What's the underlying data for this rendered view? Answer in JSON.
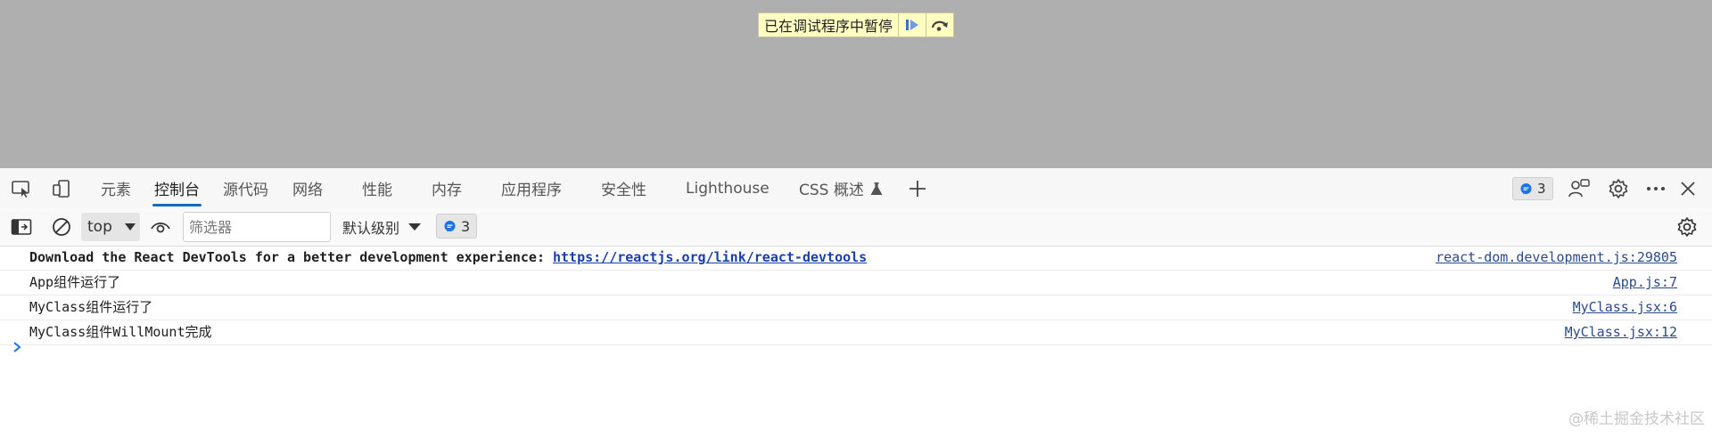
{
  "pause_banner": {
    "text": "已在调试程序中暂停",
    "resume_icon": "resume-icon",
    "step_over_icon": "step-over-icon"
  },
  "toolbar": {
    "tabs": [
      {
        "label": "元素"
      },
      {
        "label": "控制台",
        "active": true
      },
      {
        "label": "源代码"
      },
      {
        "label": "网络"
      },
      {
        "label": "性能"
      },
      {
        "label": "内存"
      },
      {
        "label": "应用程序"
      },
      {
        "label": "安全性"
      },
      {
        "label": "Lighthouse"
      },
      {
        "label": "CSS 概述"
      }
    ],
    "issues_count": "3",
    "accent": "#0f6cbd"
  },
  "console_toolbar": {
    "context": "top",
    "filter_placeholder": "筛选器",
    "level": "默认级别",
    "issues_count": "3"
  },
  "messages": [
    {
      "text": "Download the React DevTools for a better development experience: ",
      "link": "https://reactjs.org/link/react-devtools",
      "source": "react-dom.development.js:29805"
    },
    {
      "text": "App组件运行了",
      "source": "App.js:7"
    },
    {
      "text": "MyClass组件运行了",
      "source": "MyClass.jsx:6"
    },
    {
      "text": "MyClass组件WillMount完成",
      "source": "MyClass.jsx:12"
    }
  ],
  "watermark": "@稀土掘金技术社区"
}
